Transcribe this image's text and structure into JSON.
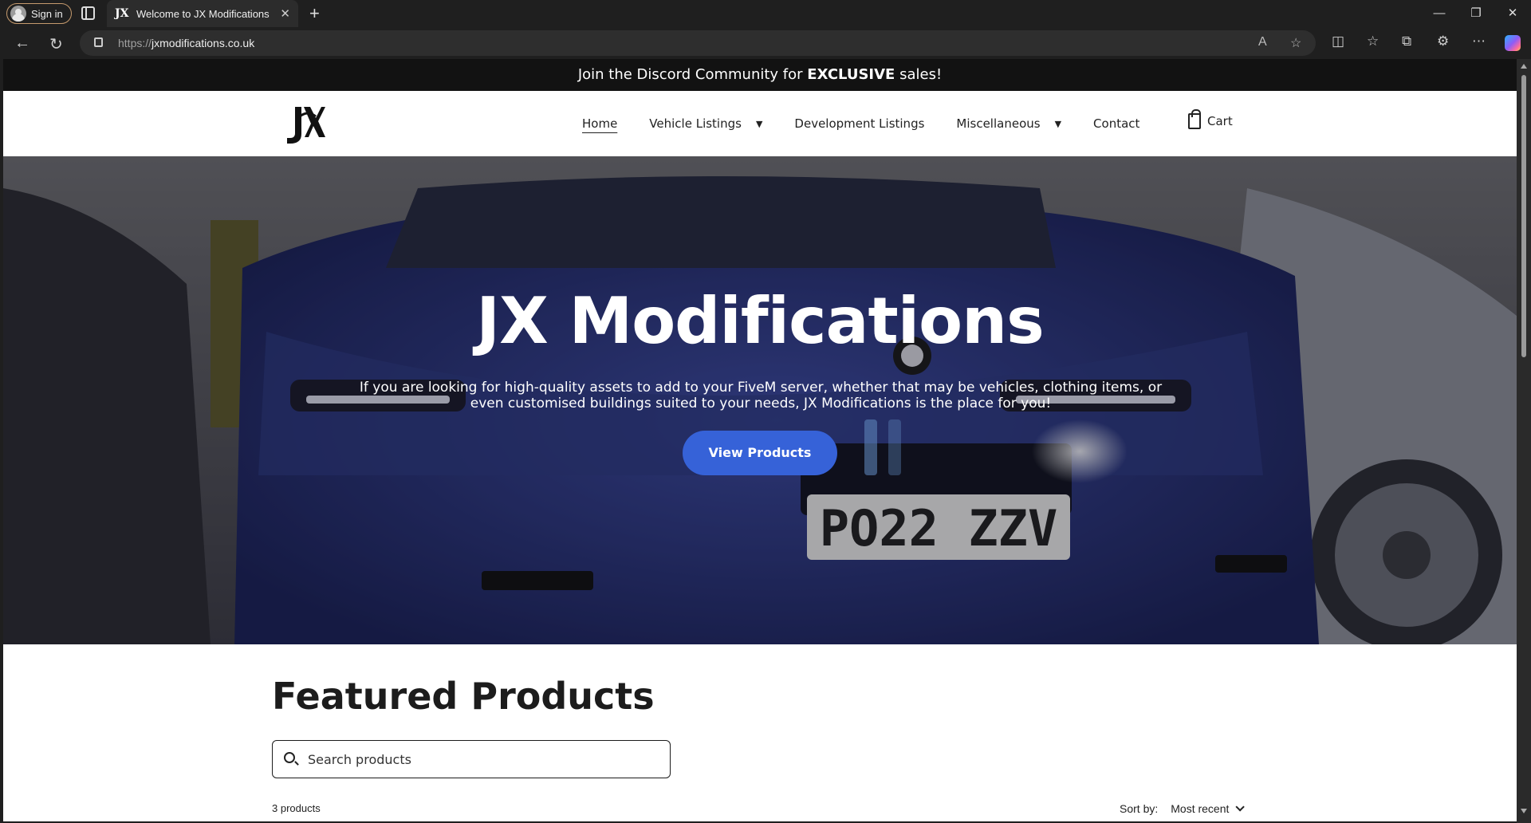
{
  "browser": {
    "signin_label": "Sign in",
    "tab_title": "Welcome to JX Modifications | JX",
    "tab_favicon": "JX",
    "url_prefix": "https://",
    "url_host": "jxmodifications.co.uk"
  },
  "announcement": {
    "text_before": "Join the Discord Community for ",
    "text_bold": "EXCLUSIVE",
    "text_after": " sales!"
  },
  "nav": {
    "items": [
      {
        "label": "Home",
        "active": true
      },
      {
        "label": "Vehicle Listings",
        "dropdown": true
      },
      {
        "label": "Development Listings"
      },
      {
        "label": "Miscellaneous",
        "dropdown": true
      },
      {
        "label": "Contact"
      }
    ],
    "cart_label": "Cart"
  },
  "hero": {
    "title": "JX Modifications",
    "description": "If you are looking for high-quality assets to add to your FiveM server, whether that may be vehicles, clothing items, or even customised buildings suited to your needs, JX Modifications is the place for you!",
    "cta_label": "View Products",
    "plate_text": "PO22 ZZV"
  },
  "featured": {
    "heading": "Featured Products",
    "search_placeholder": "Search products",
    "count_label": "3 products",
    "sort_label": "Sort by:",
    "sort_value": "Most recent"
  },
  "colors": {
    "accent": "#3662d8",
    "announce_bg": "#121212"
  }
}
